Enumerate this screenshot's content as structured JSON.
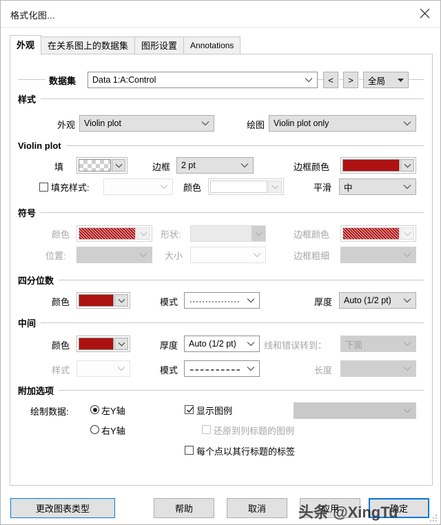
{
  "window": {
    "title": "格式化图...",
    "close_icon": "close-icon"
  },
  "tabs": [
    {
      "label": "外观",
      "active": true
    },
    {
      "label": "在关系图上的数据集",
      "active": false
    },
    {
      "label": "图形设置",
      "active": false
    },
    {
      "label": "Annotations",
      "active": false
    }
  ],
  "dataset_row": {
    "label": "数据集",
    "value": "Data 1:A:Control",
    "prev_label": "<",
    "next_label": ">",
    "scope_value": "全局"
  },
  "style_group": {
    "title": "样式",
    "appearance_label": "外观",
    "appearance_value": "Violin plot",
    "plot_label": "绘图",
    "plot_value": "Violin plot only"
  },
  "violin_group": {
    "title": "Violin plot",
    "fill_label": "填",
    "fill_swatch": "checkerboard-transparent",
    "border_label": "边框",
    "border_value": "2 pt",
    "border_color_label": "边框颜色",
    "border_color_value": "#AE1111",
    "fill_style_checkbox_label": "填充样式:",
    "fill_style_checked": false,
    "fill_style_value": "",
    "color_label": "颜色",
    "color_value": "",
    "smooth_label": "平滑",
    "smooth_value": "中"
  },
  "symbol_group": {
    "title": "符号",
    "color_label": "颜色",
    "color_value": "#AE1111",
    "shape_label": "形状:",
    "shape_value": "",
    "border_color_label": "边框颜色",
    "border_color_value": "#AE1111",
    "position_label": "位置:",
    "position_value": "",
    "size_label": "大小",
    "size_value": "",
    "border_width_label": "边框粗细",
    "border_width_value": "",
    "disabled": true
  },
  "quartile_group": {
    "title": "四分位数",
    "color_label": "颜色",
    "color_value": "#AE1111",
    "pattern_label": "模式",
    "pattern_value": "dotted-line",
    "thickness_label": "厚度",
    "thickness_value": "Auto (1/2 pt)"
  },
  "median_group": {
    "title": "中间",
    "color_label": "颜色",
    "color_value": "#AE1111",
    "thickness_label": "厚度",
    "thickness_value": "Auto (1/2 pt)",
    "line_error_label": "线和错误转到：",
    "line_error_value": "下面",
    "style_label": "样式",
    "style_value": "",
    "pattern_label": "模式",
    "pattern_value": "dashed-line",
    "length_label": "长度",
    "length_value": ""
  },
  "extra_group": {
    "title": "附加选项",
    "plot_data_label": "绘制数据:",
    "left_axis_label": "左Y轴",
    "right_axis_label": "右Y轴",
    "axis_selected": "left",
    "show_legend_label": "显示图例",
    "show_legend_checked": true,
    "legend_value": "",
    "restore_legend_label": "还原到列标题的图例",
    "restore_legend_checked": false,
    "restore_legend_disabled": true,
    "point_label_label": "每个点以其行标题的标签",
    "point_label_checked": false
  },
  "footer": {
    "change_chart_type": "更改图表类型",
    "help": "帮助",
    "cancel": "取消",
    "apply": "应用",
    "ok": "确定"
  },
  "watermark": {
    "text": "头条 @XingTu"
  }
}
